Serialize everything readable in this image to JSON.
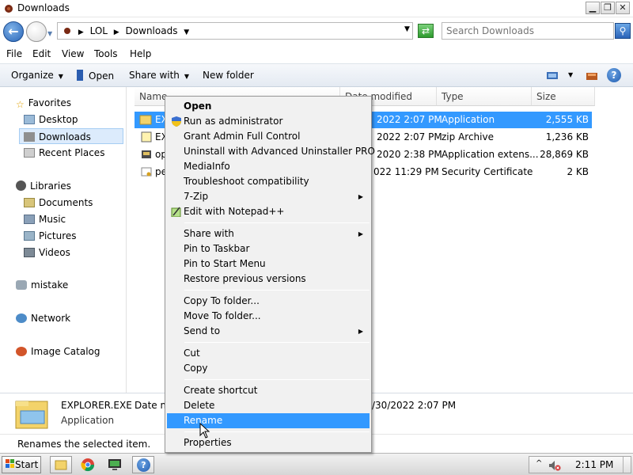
{
  "window": {
    "title": "Downloads"
  },
  "address": {
    "crumbs": [
      "LOL",
      "Downloads"
    ],
    "search_placeholder": "Search Downloads"
  },
  "menubar": [
    "File",
    "Edit",
    "View",
    "Tools",
    "Help"
  ],
  "toolbar": {
    "organize": "Organize",
    "open": "Open",
    "share_with": "Share with",
    "new_folder": "New folder"
  },
  "nav": {
    "favorites": "Favorites",
    "desktop": "Desktop",
    "downloads": "Downloads",
    "recent_places": "Recent Places",
    "libraries": "Libraries",
    "documents": "Documents",
    "music": "Music",
    "pictures": "Pictures",
    "videos": "Videos",
    "mistake": "mistake",
    "network": "Network",
    "image_catalog": "Image Catalog"
  },
  "columns": {
    "name": "Name",
    "date_modified": "Date modified",
    "type": "Type",
    "size": "Size"
  },
  "files": [
    {
      "name": "EX",
      "date": "2022 2:07 PM",
      "type": "Application",
      "size": "2,555 KB"
    },
    {
      "name": "EX",
      "date": "2022 2:07 PM",
      "type": "zip Archive",
      "size": "1,236 KB"
    },
    {
      "name": "op",
      "date": "2020 2:38 PM",
      "type": "Application extens...",
      "size": "28,869 KB"
    },
    {
      "name": "pe",
      "date": "022 11:29 PM",
      "type": "Security Certificate",
      "size": "2 KB"
    }
  ],
  "details": {
    "filename": "EXPLORER.EXE",
    "date_label": "Date m",
    "date_value": "/30/2022 2:07 PM",
    "type": "Application"
  },
  "status": "Renames the selected item.",
  "context_menu": {
    "open": "Open",
    "run_as_admin": "Run as administrator",
    "grant_admin": "Grant Admin Full Control",
    "uninstall": "Uninstall with Advanced Uninstaller PRO",
    "mediainfo": "MediaInfo",
    "troubleshoot": "Troubleshoot compatibility",
    "sevenzip": "7-Zip",
    "notepadpp": "Edit with Notepad++",
    "share_with": "Share with",
    "pin_taskbar": "Pin to Taskbar",
    "pin_start": "Pin to Start Menu",
    "restore": "Restore previous versions",
    "copy_to": "Copy To folder...",
    "move_to": "Move To folder...",
    "send_to": "Send to",
    "cut": "Cut",
    "copy": "Copy",
    "create_shortcut": "Create shortcut",
    "delete": "Delete",
    "rename": "Rename",
    "properties": "Properties"
  },
  "taskbar": {
    "start": "Start",
    "clock": "2:11 PM"
  }
}
